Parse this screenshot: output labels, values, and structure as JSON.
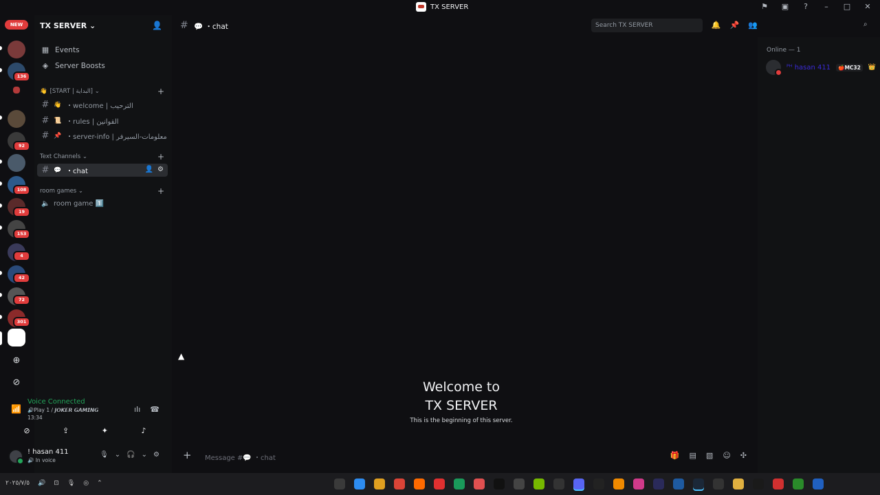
{
  "window": {
    "title": "TX SERVER",
    "controls": [
      "–",
      "□",
      "✕"
    ],
    "top_icons": [
      "inbox-icon",
      "monitor-icon",
      "help-icon"
    ]
  },
  "guilds": {
    "new_badge": "NEW",
    "badges": [
      "136",
      "92",
      "108",
      "19",
      "153",
      "4",
      "42",
      "72",
      "301"
    ],
    "colors": [
      "#7a3a3a",
      "#2d4a6b",
      "#b33a3a",
      "#5a4a3a",
      "#3a3a3a",
      "#4a5a6a",
      "#2d5a8b",
      "#5a2a2a",
      "#444",
      "#3a3a5a",
      "#2a4a7a",
      "#555",
      "#8b2a2a",
      "#6b1a1a",
      "#c0392b"
    ]
  },
  "server": {
    "name": "TX SERVER ⌄",
    "nav": [
      "Events",
      "Server Boosts"
    ]
  },
  "categories": {
    "start": "[START | البداية] ⌄",
    "text": "Text Channels ⌄",
    "games": "room games ⌄"
  },
  "channels": {
    "welcome": {
      "emoji": "👋",
      "name": "・welcome | الترحيب"
    },
    "rules": {
      "emoji": "📜",
      "name": "・rules | القوانين"
    },
    "info": {
      "emoji": "📌",
      "name": "・server-info | معلومات-السيرفر"
    },
    "chat": {
      "emoji": "💬",
      "name": "・chat"
    },
    "voice": {
      "name": "room game 1️⃣"
    }
  },
  "voice": {
    "status": "Voice Connected",
    "room": "🔊Play 1 / 𝙅𝙊𝙆𝙀𝙍 𝙂𝘼𝙈𝙄𝙉𝙂",
    "time": "13:34"
  },
  "user": {
    "name": "! hasan 411",
    "status": "🔊 In voice"
  },
  "header": {
    "title": "💬 ・chat",
    "search_placeholder": "Search TX SERVER"
  },
  "welcome": {
    "line1": "Welcome to",
    "line2": "TX SERVER",
    "sub": "This is the beginning of this server."
  },
  "composer": {
    "placeholder": "Message #💬 ・chat"
  },
  "members": {
    "heading": "Online — 1",
    "list": [
      {
        "name": "ᴾᴴ hasan 411",
        "tag": "🍎MC32",
        "crown": "👑"
      }
    ]
  },
  "taskbar": {
    "date": "٢٠٢٥/٧/٥",
    "apps": [
      "#3a3a3a",
      "#2d8cf0",
      "#e0a020",
      "#db4437",
      "#ff6a00",
      "#e03030",
      "#1a9a5a",
      "#e05050",
      "#111",
      "#444",
      "#76b900",
      "#333",
      "#5865f2",
      "#222",
      "#f08a00",
      "#d03a8a",
      "#2a2a5a",
      "#1e5aa0",
      "#1b2838",
      "#333",
      "#e0b040",
      "#1a1a1a",
      "#d03030",
      "#2a8a2a",
      "#2060c0"
    ]
  }
}
